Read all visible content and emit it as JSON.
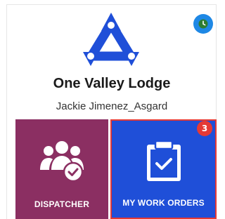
{
  "header": {
    "org_name": "One Valley Lodge",
    "user_name": "Jackie Jimenez_Asgard",
    "logo_icon": "triangle-nodes-logo-icon",
    "status_icon": "clock-icon"
  },
  "tiles": [
    {
      "label": "DISPATCHER",
      "icon": "users-check-icon",
      "color": "#8b2f62"
    },
    {
      "label": "MY WORK ORDERS",
      "icon": "clipboard-check-icon",
      "color": "#1f4fd8",
      "badge": "3",
      "highlight_color": "#e53935"
    }
  ],
  "colors": {
    "brand_blue": "#1f4fd8",
    "status_blue": "#1e88e5",
    "status_green": "#2e7d32",
    "badge_red": "#e53935"
  }
}
